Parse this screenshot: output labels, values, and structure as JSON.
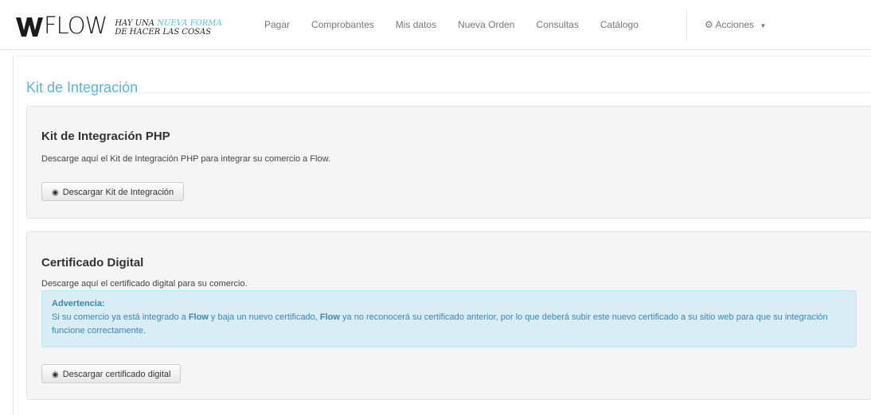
{
  "brand": {
    "name": "FLOW",
    "tagline_line1_prefix": "HAY UNA",
    "tagline_line1_accent": "NUEVA FORMA",
    "tagline_line2": "DE HACER LAS COSAS"
  },
  "nav": {
    "items": [
      "Pagar",
      "Comprobantes",
      "Mis datos",
      "Nueva Orden",
      "Consultas",
      "Catálogo"
    ],
    "actions_label": "Acciones"
  },
  "page": {
    "title": "Kit de Integración"
  },
  "php_kit": {
    "heading": "Kit de Integración PHP",
    "description": "Descarge aquí el Kit de Integración PHP para integrar su comercio a Flow.",
    "button_label": "Descargar Kit de Integración"
  },
  "certificate": {
    "heading": "Certificado Digital",
    "description": "Descarge aquí el certificado digital para su comercio.",
    "warning_title": "Advertencia:",
    "warning_part1": "Si su comercio ya está integrado a ",
    "warning_flow1": "Flow",
    "warning_part2": " y baja un nuevo certificado, ",
    "warning_flow2": "Flow",
    "warning_part3": " ya no reconocerá su certificado anterior, por lo que deberá subir este nuevo certificado a su sitio web para que su integración funcione correctamente.",
    "button_label": "Descargar certificado digital"
  },
  "colors": {
    "accent": "#5bc0de",
    "title": "#5ab5d6",
    "alert_bg": "#d9edf7",
    "alert_text": "#3a87ad"
  },
  "icons": {
    "download": "download-icon",
    "gear": "gear-icon",
    "caret": "caret-down-icon"
  }
}
